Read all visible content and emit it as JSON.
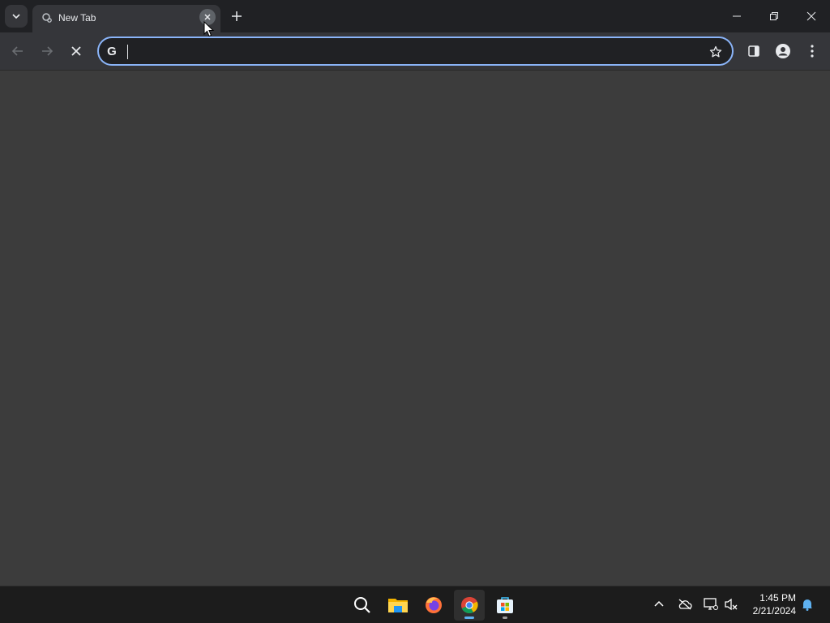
{
  "browser": {
    "tab": {
      "title": "New Tab"
    },
    "omnibox": {
      "value": "",
      "placeholder": ""
    }
  },
  "icons": {
    "tab_search": "chevron-down-icon",
    "tab_favicon": "loading-icon",
    "tab_close": "close-icon",
    "new_tab": "plus-icon",
    "minimize": "minimize-icon",
    "restore": "restore-icon",
    "close_window": "close-icon",
    "back": "arrow-left-icon",
    "forward": "arrow-right-icon",
    "stop": "close-icon",
    "search_engine": "google-icon",
    "bookmark": "star-icon",
    "side_panel": "side-panel-icon",
    "profile": "profile-icon",
    "menu": "kebab-icon"
  },
  "taskbar": {
    "apps": [
      "Search",
      "File Explorer",
      "Firefox",
      "Google Chrome",
      "Microsoft Store"
    ],
    "clock": {
      "time": "1:45 PM",
      "date": "2/21/2024"
    }
  },
  "colors": {
    "accent": "#8ab4f8",
    "tab_bg": "#35363a",
    "frame_bg": "#202124",
    "content_bg": "#3c3c3c",
    "taskbar_bg": "#1c1c1c"
  }
}
